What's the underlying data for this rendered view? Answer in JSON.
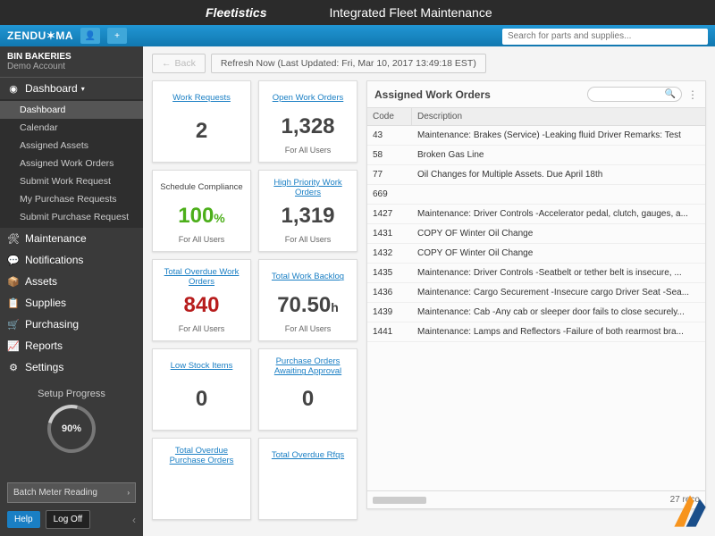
{
  "header": {
    "brand": "Fleetistics",
    "title": "Integrated Fleet Maintenance"
  },
  "ribbon": {
    "logo": "ZENDU✶MA",
    "search_placeholder": "Search for parts and supplies..."
  },
  "account": {
    "name": "BIN BAKERIES",
    "sub": "Demo Account"
  },
  "nav": {
    "dashboard": {
      "label": "Dashboard",
      "items": [
        "Dashboard",
        "Calendar",
        "Assigned Assets",
        "Assigned Work Orders",
        "Submit Work Request",
        "My Purchase Requests",
        "Submit Purchase Request"
      ]
    },
    "sections": [
      {
        "icon": "🛠",
        "label": "Maintenance"
      },
      {
        "icon": "💬",
        "label": "Notifications"
      },
      {
        "icon": "📦",
        "label": "Assets"
      },
      {
        "icon": "📋",
        "label": "Supplies"
      },
      {
        "icon": "🛒",
        "label": "Purchasing"
      },
      {
        "icon": "📈",
        "label": "Reports"
      },
      {
        "icon": "⚙",
        "label": "Settings"
      }
    ]
  },
  "setup": {
    "label": "Setup Progress",
    "pct": "90%"
  },
  "side_buttons": {
    "batch": "Batch Meter Reading",
    "help": "Help",
    "logoff": "Log Off"
  },
  "toolbar": {
    "back": "Back",
    "refresh": "Refresh Now (Last Updated: Fri, Mar 10, 2017 13:49:18 EST)"
  },
  "cards": [
    {
      "title": "Work Requests",
      "value": "2",
      "link": true,
      "foot": ""
    },
    {
      "title": "Open Work Orders",
      "value": "1,328",
      "link": true,
      "foot": "For All Users"
    },
    {
      "title": "Schedule Compliance",
      "value": "100",
      "unit": "%",
      "link": false,
      "color": "green",
      "foot": "For All Users"
    },
    {
      "title": "High Priority Work Orders",
      "value": "1,319",
      "link": true,
      "foot": "For All Users"
    },
    {
      "title": "Total Overdue Work Orders",
      "value": "840",
      "link": true,
      "color": "red",
      "foot": "For All Users"
    },
    {
      "title": "Total Work Backlog",
      "value": "70.50",
      "unit": "h",
      "link": true,
      "foot": "For All Users"
    },
    {
      "title": "Low Stock Items",
      "value": "0",
      "link": true,
      "foot": ""
    },
    {
      "title": "Purchase Orders Awaiting Approval",
      "value": "0",
      "link": true,
      "foot": ""
    },
    {
      "title": "Total Overdue Purchase Orders",
      "value": "",
      "link": true,
      "foot": ""
    },
    {
      "title": "Total Overdue Rfqs",
      "value": "",
      "link": true,
      "foot": ""
    }
  ],
  "panel": {
    "title": "Assigned Work Orders",
    "cols": {
      "code": "Code",
      "desc": "Description"
    },
    "rows": [
      {
        "code": "43",
        "desc": "Maintenance: Brakes (Service) -Leaking fluid Driver Remarks: Test"
      },
      {
        "code": "58",
        "desc": "Broken Gas Line"
      },
      {
        "code": "77",
        "desc": "Oil Changes for Multiple Assets. Due April 18th"
      },
      {
        "code": "669",
        "desc": ""
      },
      {
        "code": "1427",
        "desc": "Maintenance: Driver Controls -Accelerator pedal, clutch, gauges, a..."
      },
      {
        "code": "1431",
        "desc": "COPY OF Winter Oil Change"
      },
      {
        "code": "1432",
        "desc": "COPY OF Winter Oil Change"
      },
      {
        "code": "1435",
        "desc": "Maintenance: Driver Controls -Seatbelt or tether belt is insecure, ..."
      },
      {
        "code": "1436",
        "desc": "Maintenance: Cargo Securement -Insecure cargo Driver Seat -Sea..."
      },
      {
        "code": "1439",
        "desc": "Maintenance: Cab -Any cab or sleeper door fails to close securely..."
      },
      {
        "code": "1441",
        "desc": "Maintenance: Lamps and Reflectors -Failure of both rearmost bra..."
      }
    ],
    "record_count": "27 reco"
  }
}
